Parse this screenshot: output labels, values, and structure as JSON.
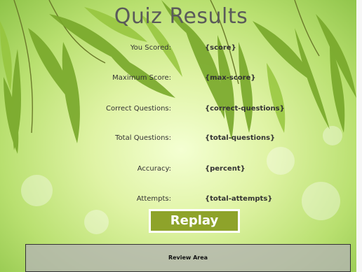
{
  "title": "Quiz Results",
  "rows": [
    {
      "label": "You Scored:",
      "value": "{score}"
    },
    {
      "label": "Maximum Score:",
      "value": "{max-score}"
    },
    {
      "label": "Correct Questions:",
      "value": "{correct-questions}"
    },
    {
      "label": "Total Questions:",
      "value": "{total-questions}"
    },
    {
      "label": "Accuracy:",
      "value": "{percent}"
    },
    {
      "label": "Attempts:",
      "value": "{total-attempts}"
    }
  ],
  "replay_label": "Replay",
  "review_label": "Review Area",
  "colors": {
    "accent": "#8ea32a",
    "title": "#5a5a5a"
  }
}
